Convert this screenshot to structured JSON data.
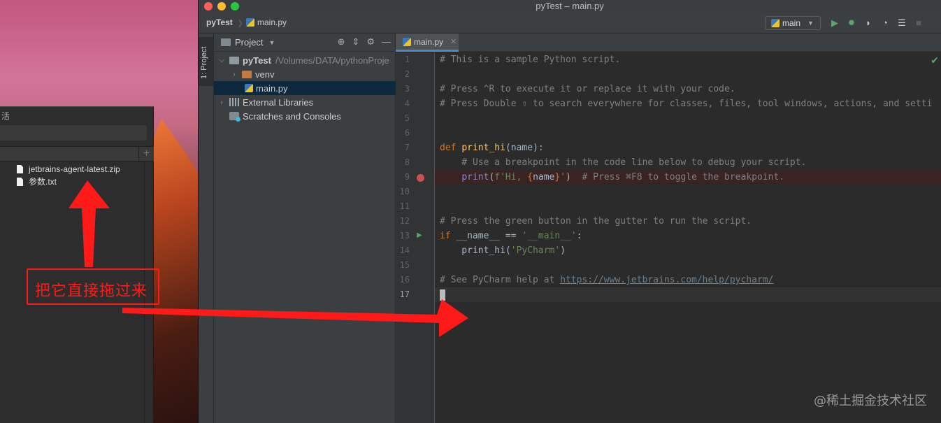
{
  "finder": {
    "title_fragment": "活",
    "files": [
      "jetbrains-agent-latest.zip",
      "参数.txt"
    ],
    "plus_label": "+"
  },
  "annotation": {
    "text": "把它直接拖过来",
    "color": "#ff1a1a"
  },
  "ide": {
    "window_title": "pyTest – main.py",
    "breadcrumb": {
      "project": "pyTest",
      "separator": "〉",
      "file": "main.py"
    },
    "run_config": "main",
    "toolbar_icons": [
      "run-icon",
      "debug-icon",
      "coverage-icon",
      "profile-icon",
      "concurrency-icon",
      "stop-icon"
    ],
    "side_strip_label": "1: Project",
    "project_panel": {
      "header": "Project",
      "tree": [
        {
          "label": "pyTest",
          "detail": "/Volumes/DATA/pythonProje",
          "level": 0,
          "expanded": true,
          "bold": true
        },
        {
          "label": "venv",
          "level": 1,
          "expanded": false
        },
        {
          "label": "main.py",
          "level": 1,
          "selected": true
        },
        {
          "label": "External Libraries",
          "level": 0,
          "expanded": false
        },
        {
          "label": "Scratches and Consoles",
          "level": 0
        }
      ]
    },
    "editor": {
      "tab": "main.py",
      "current_line": 17,
      "breakpoint_line": 9,
      "run_gutter_line": 13,
      "line_numbers": [
        "1",
        "2",
        "3",
        "4",
        "5",
        "6",
        "7",
        "8",
        "9",
        "10",
        "11",
        "12",
        "13",
        "14",
        "15",
        "16",
        "17"
      ],
      "lines": [
        "# This is a sample Python script.",
        "",
        "# Press ^R to execute it or replace it with your code.",
        "# Press Double ⇧ to search everywhere for classes, files, tool windows, actions, and setti",
        "",
        "",
        "def print_hi(name):",
        "    # Use a breakpoint in the code line below to debug your script.",
        "    print(f'Hi, {name}')  # Press ⌘F8 to toggle the breakpoint.",
        "",
        "",
        "# Press the green button in the gutter to run the script.",
        "if __name__ == '__main__':",
        "    print_hi('PyCharm')",
        "",
        "# See PyCharm help at https://www.jetbrains.com/help/pycharm/",
        ""
      ]
    }
  },
  "watermark": "@稀土掘金技术社区"
}
